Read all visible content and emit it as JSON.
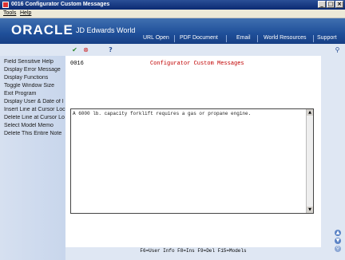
{
  "window": {
    "title": "0016   Configurator Custom Messages"
  },
  "menu": {
    "items": [
      "Tools",
      "Help"
    ]
  },
  "banner": {
    "logo": "ORACLE",
    "product": "JD Edwards World",
    "links": [
      "URL Open",
      "PDF Document",
      "Email",
      "World Resources",
      "Support"
    ]
  },
  "toolbar": {
    "ok_icon": "check-icon",
    "cancel_icon": "cancel-icon",
    "help_label": "?"
  },
  "sidebar": {
    "items": [
      "Field Sensitive Help",
      "Display Error Message",
      "Display Functions",
      "Toggle Window Size",
      "Exit Program",
      "Display User & Date of I",
      "Insert Line at Cursor Loc",
      "Delete Line at Cursor Lo",
      "Select Model Memo",
      "Delete This Entire Note"
    ]
  },
  "form": {
    "program_id": "0016",
    "title": "Configurator Custom Messages",
    "message_text": "A 6000 lb. capacity forklift requires a gas or propane engine."
  },
  "footer": {
    "function_keys": "F6=User Info  F8=Ins  F9=Del  F15=Models"
  }
}
